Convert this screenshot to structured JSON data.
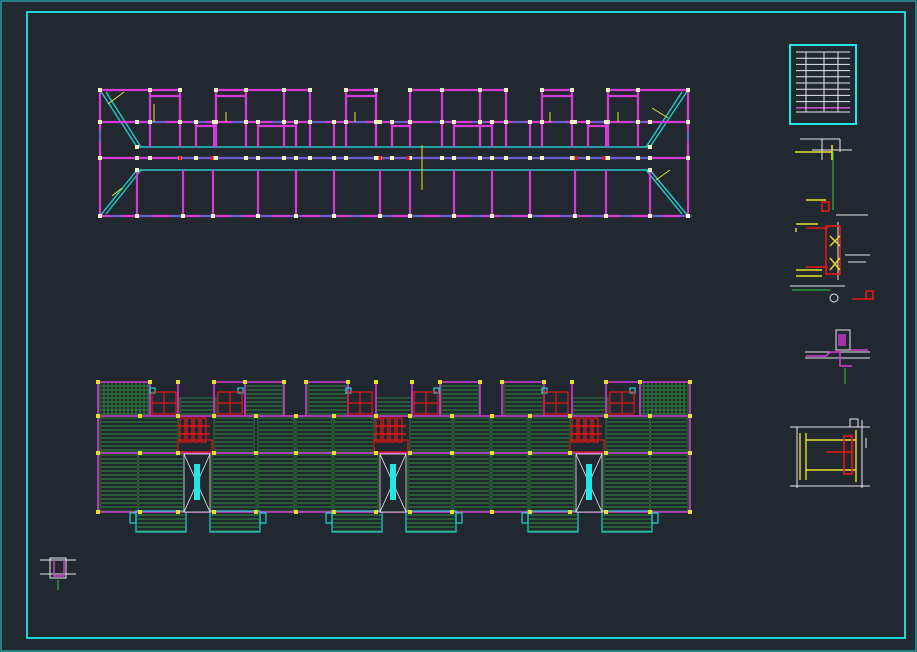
{
  "canvas": {
    "background": "#212830",
    "frame_color": "#22d3d3",
    "wall_color": "#d63bd6",
    "column_color": "#f3f3c0",
    "beam_color": "#3a6fd0",
    "slab_hatch_color": "#2e8b3c",
    "rebar_red": "#e01818",
    "accent_yellow": "#e6e02a",
    "accent_cyan": "#22e6e6",
    "accent_white": "#e8e8e8"
  },
  "views": [
    {
      "id": "floor-plan",
      "kind": "structural-plan"
    },
    {
      "id": "slab-layout",
      "kind": "slab-reinforcement-plan"
    },
    {
      "id": "table",
      "kind": "legend-table"
    },
    {
      "id": "details",
      "kind": "section-details",
      "count": 4
    }
  ]
}
